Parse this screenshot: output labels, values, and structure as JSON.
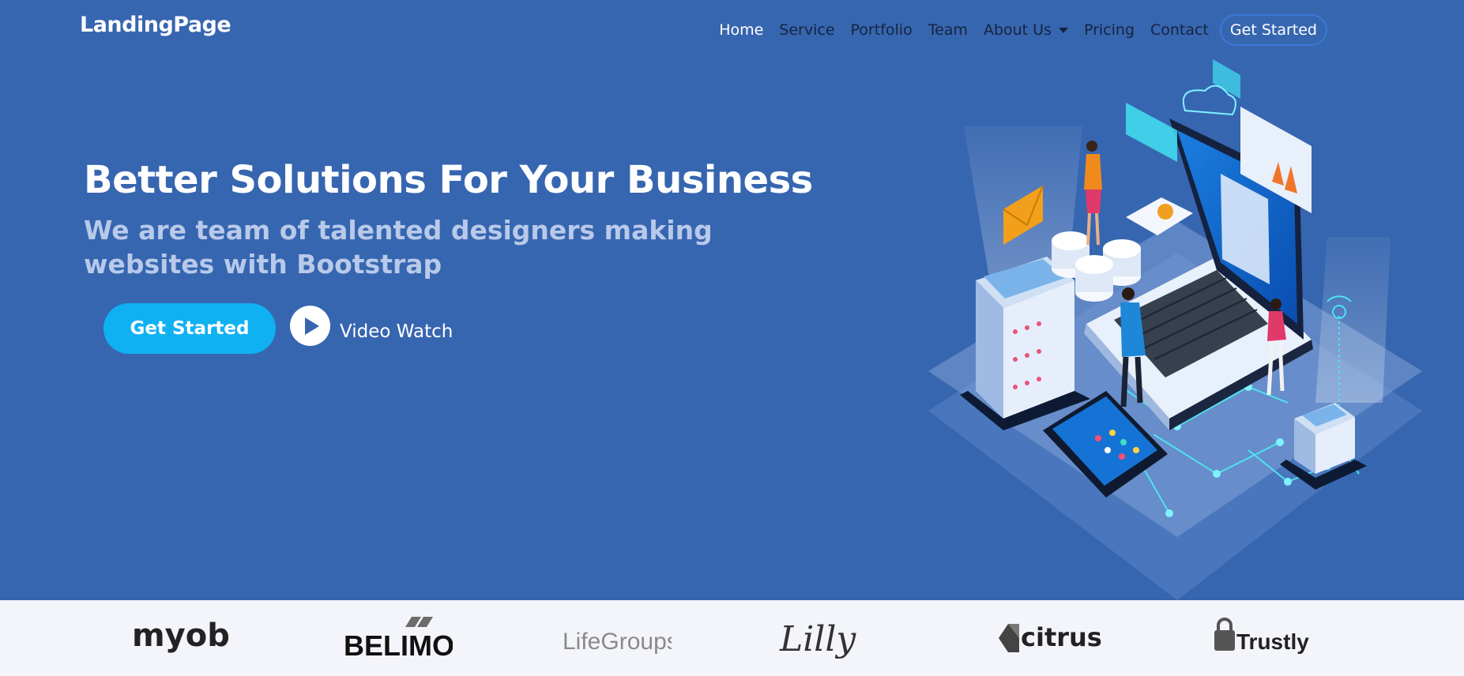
{
  "navbar": {
    "brand": "LandingPage",
    "links": [
      {
        "label": "Home"
      },
      {
        "label": "Service"
      },
      {
        "label": "Portfolio"
      },
      {
        "label": "Team"
      },
      {
        "label": "About Us"
      },
      {
        "label": "Pricing"
      },
      {
        "label": "Contact"
      }
    ],
    "cta_label": "Get Started"
  },
  "hero": {
    "title": "Better Solutions For Your Business",
    "subtitle": "We are team of talented designers making websites with Bootstrap",
    "primary_button": "Get Started",
    "video_label": "Video Watch"
  },
  "clients": [
    {
      "name": "myob"
    },
    {
      "name": "BELIMO"
    },
    {
      "name": "LifeGroups"
    },
    {
      "name": "Lilly"
    },
    {
      "name": "citrus"
    },
    {
      "name": "Trustly"
    }
  ],
  "colors": {
    "hero_bg": "#3766b0",
    "accent": "#0fb1f3",
    "clients_bg": "#f3f5fa",
    "nav_text": "#16243f"
  },
  "icons": [
    "play-icon",
    "dropdown-caret-icon"
  ]
}
